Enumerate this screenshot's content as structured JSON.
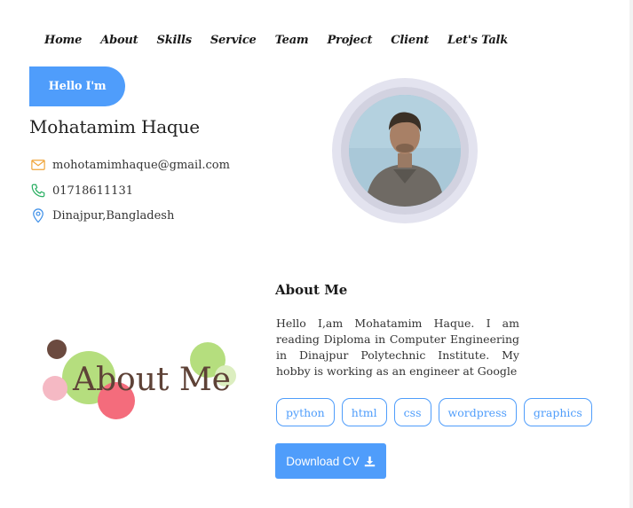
{
  "nav": {
    "items": [
      "Home",
      "About",
      "Skills",
      "Service",
      "Team",
      "Project",
      "Client",
      "Let's Talk"
    ]
  },
  "hero": {
    "greeting": "Hello I'm",
    "name": "Mohatamim Haque",
    "email": "mohotamimhaque@gmail.com",
    "phone": "01718611131",
    "location": "Dinajpur,Bangladesh"
  },
  "about": {
    "heading": "About Me",
    "art_text": "About Me",
    "text": "Hello I,am Mohatamim Haque. I am reading Diploma in Computer Engineering in Dinajpur Polytechnic Institute. My hobby is working as an engineer at Google",
    "skills": [
      "python",
      "html",
      "css",
      "wordpress",
      "graphics"
    ],
    "download_label": "Download CV"
  },
  "colors": {
    "accent": "#4f9dfb",
    "email_icon": "#f0a53a",
    "phone_icon": "#27ae60",
    "location_icon": "#3b8ee8"
  },
  "icons": {
    "email": "envelope-icon",
    "phone": "phone-icon",
    "location": "map-pin-icon",
    "download": "download-icon"
  }
}
